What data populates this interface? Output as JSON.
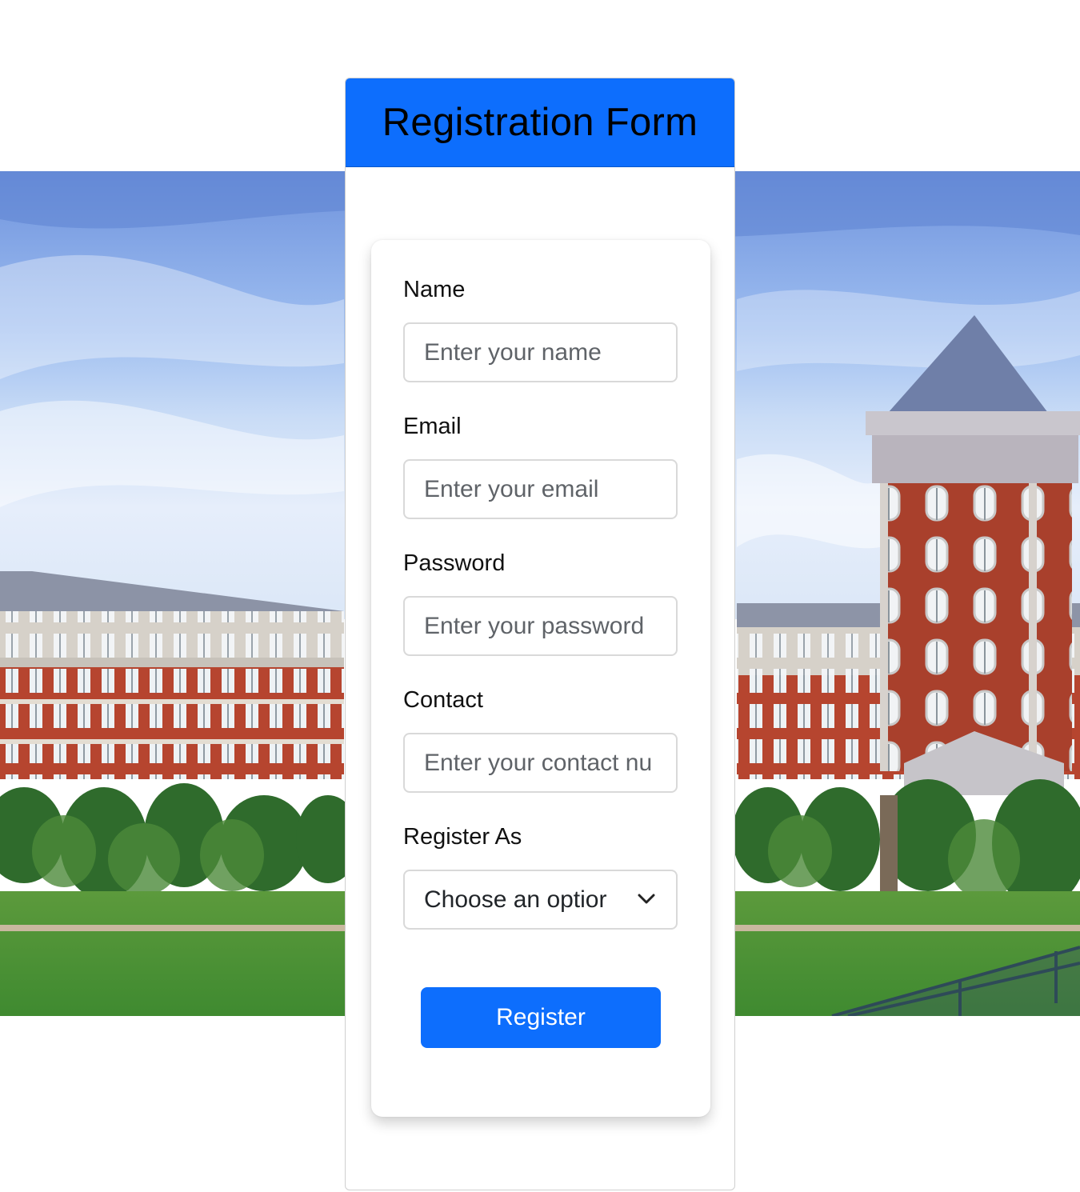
{
  "header": {
    "title": "Registration Form"
  },
  "form": {
    "fields": [
      {
        "label": "Name",
        "placeholder": "Enter your name",
        "value": ""
      },
      {
        "label": "Email",
        "placeholder": "Enter your email",
        "value": ""
      },
      {
        "label": "Password",
        "placeholder": "Enter your password",
        "value": ""
      },
      {
        "label": "Contact",
        "placeholder": "Enter your contact nu",
        "value": ""
      }
    ],
    "register_as": {
      "label": "Register As",
      "selected": "Choose an optior"
    },
    "submit_label": "Register"
  },
  "colors": {
    "accent": "#0d6efd",
    "header_text": "#000000",
    "button_text": "#ffffff"
  },
  "background_image": "campus-building-photo"
}
